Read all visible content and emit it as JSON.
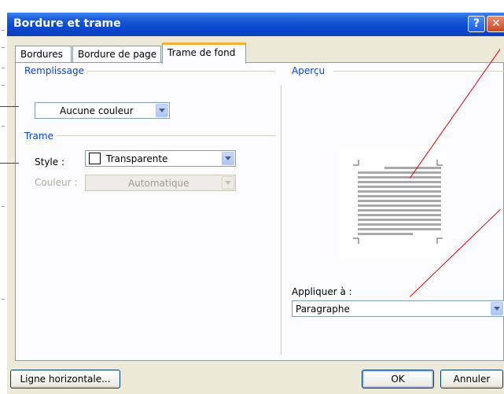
{
  "window": {
    "title": "Bordure et trame"
  },
  "titlebar": {
    "help_glyph": "?",
    "close_glyph": "✕"
  },
  "tabs": [
    {
      "label": "Bordures",
      "key": "B"
    },
    {
      "label": "Bordure de page",
      "key": "p"
    },
    {
      "label": "Trame de fond",
      "key": "T",
      "active": true
    }
  ],
  "fill": {
    "group_label": "Remplissage",
    "value": "Aucune couleur"
  },
  "pattern": {
    "group_label": "Trame",
    "style_label": "Style :",
    "style_value": "Transparente",
    "color_label": "Couleur :",
    "color_value": "Automatique"
  },
  "preview": {
    "group_label": "Aperçu"
  },
  "apply": {
    "label": "Appliquer à :",
    "value": "Paragraphe"
  },
  "buttons": {
    "horizontal_line": "Ligne horizontale...",
    "ok": "OK",
    "cancel": "Annuler"
  },
  "colors": {
    "title_bar": "#0a4ad0",
    "group_label": "#0046d5",
    "dialog_bg": "#ece9d8",
    "annotation": "#e00000"
  }
}
